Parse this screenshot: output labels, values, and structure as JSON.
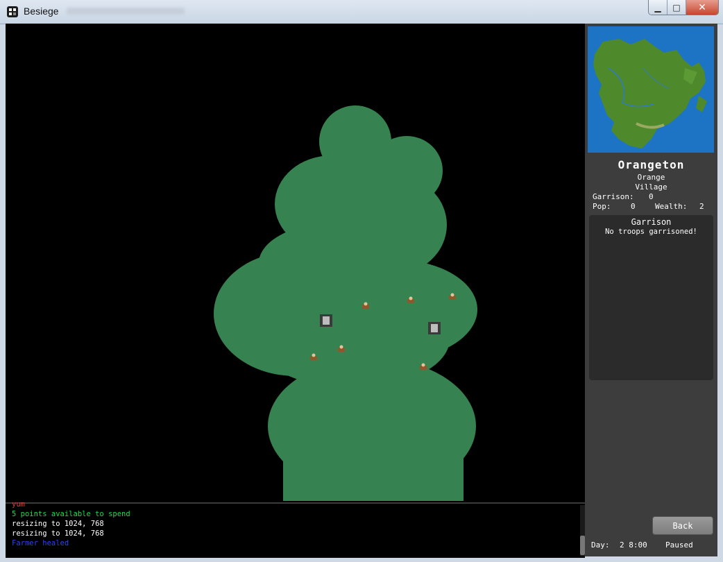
{
  "window": {
    "title": "Besiege",
    "minimize_label": "▁",
    "maximize_label": "□",
    "close_label": "✕"
  },
  "colors": {
    "terrain": "#368251",
    "ocean": "#1d73c4",
    "land": "#4e8a2c",
    "sidebar_bg": "#3d3d3d"
  },
  "log": {
    "lines": [
      {
        "text": "yum",
        "color": "#e53b2c"
      },
      {
        "text": "5 points available to spend",
        "color": "#20d84a"
      },
      {
        "text": "resizing to 1024, 768",
        "color": "#ffffff"
      },
      {
        "text": "resizing to 1024, 768",
        "color": "#ffffff"
      },
      {
        "text": "Farmer healed",
        "color": "#2b45e8"
      }
    ]
  },
  "location": {
    "name": "Orangeton",
    "faction": "Orange",
    "type": "Village",
    "garrison_label": "Garrison:",
    "garrison_value": "0",
    "pop_label": "Pop:",
    "pop_value": "0",
    "wealth_label": "Wealth:",
    "wealth_value": "2"
  },
  "garrison_panel": {
    "title": "Garrison",
    "empty_text": "No troops garrisoned!"
  },
  "back_button": "Back",
  "status": {
    "day_label": "Day:",
    "day_value": "2 8:00",
    "state": "Paused"
  },
  "units": [
    {
      "icon": "farmer-unit-icon",
      "kind": "farmer"
    },
    {
      "icon": "farmer-unit-icon",
      "kind": "farmer"
    },
    {
      "icon": "farmer-unit-icon",
      "kind": "farmer"
    },
    {
      "icon": "farmer-unit-icon",
      "kind": "farmer"
    },
    {
      "icon": "farmer-unit-icon",
      "kind": "farmer"
    },
    {
      "icon": "farmer-unit-icon",
      "kind": "farmer"
    },
    {
      "icon": "knight-unit-icon",
      "kind": "armored"
    },
    {
      "icon": "knight-unit-icon",
      "kind": "armored"
    }
  ]
}
